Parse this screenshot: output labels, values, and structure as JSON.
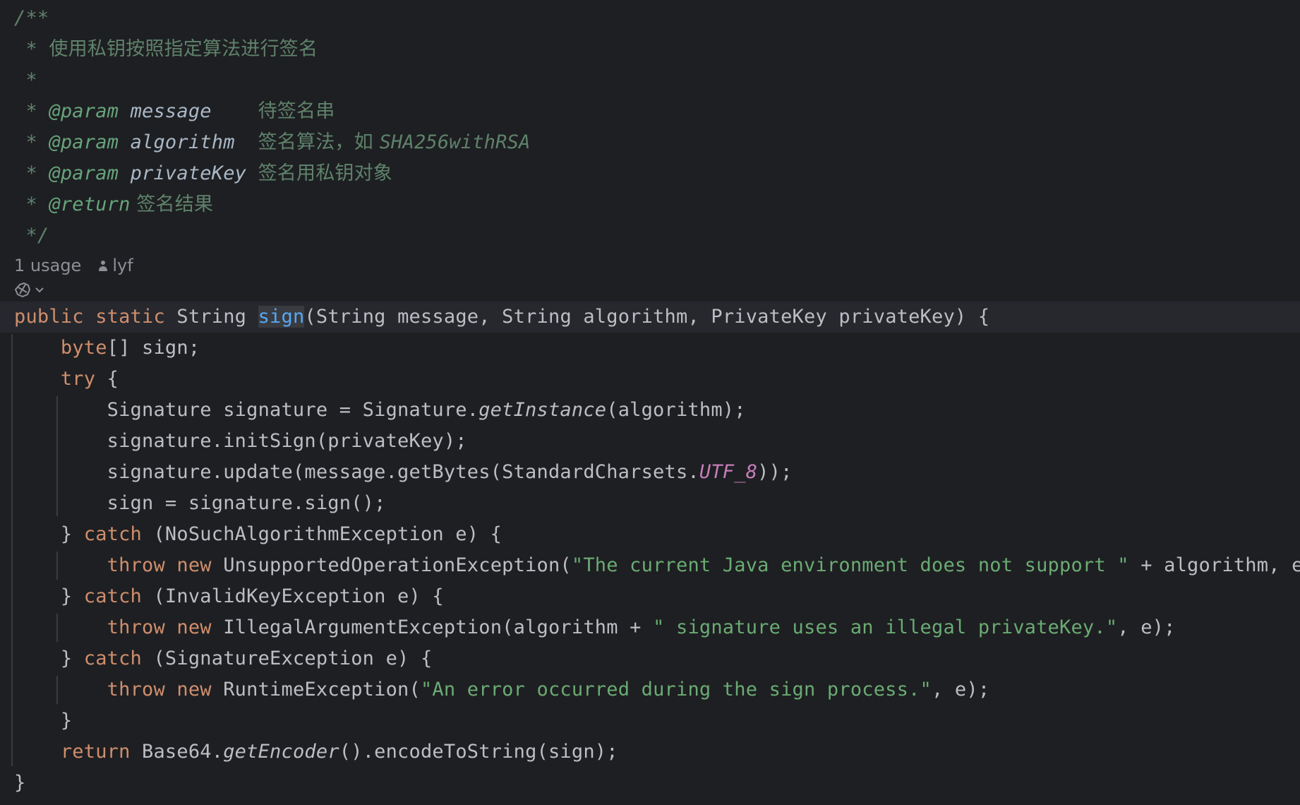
{
  "javadoc": {
    "open": "/**",
    "summary_star": " * ",
    "summary": "使用私钥按照指定算法进行签名",
    "blank": " *",
    "params": [
      {
        "star": " * ",
        "tag": "@param",
        "name": " message",
        "pad": "    ",
        "desc": "待签名串",
        "desc_code": ""
      },
      {
        "star": " * ",
        "tag": "@param",
        "name": " algorithm",
        "pad": "  ",
        "desc": "签名算法，如 ",
        "desc_code": "SHA256withRSA"
      },
      {
        "star": " * ",
        "tag": "@param",
        "name": " privateKey",
        "pad": " ",
        "desc": "签名用私钥对象",
        "desc_code": ""
      }
    ],
    "return_star": " * ",
    "return_tag": "@return",
    "return_desc": " 签名结果",
    "close": " */"
  },
  "inlay_hint": {
    "usages": "1 usage",
    "author": "lyf"
  },
  "code": {
    "signature": {
      "kw_public": "public",
      "kw_static": " static",
      "return_type": " String ",
      "name": "sign",
      "params": "(String message, String algorithm, PrivateKey privateKey) {"
    },
    "l_byte_kw": "    byte",
    "l_byte_rest": "[] sign;",
    "l_try_kw": "    try",
    "l_try_rest": " {",
    "l_sig_1": "        Signature signature = Signature.",
    "l_sig_2": "getInstance",
    "l_sig_3": "(algorithm);",
    "l_init": "        signature.initSign(privateKey);",
    "l_upd_1": "        signature.update(message.getBytes(StandardCharsets.",
    "l_upd_2": "UTF_8",
    "l_upd_3": "));",
    "l_sign": "        sign = signature.sign();",
    "catches": [
      {
        "open": "    } ",
        "kw": "catch",
        "type": " (NoSuchAlgorithmException e) {",
        "throw_indent": "        ",
        "throw_kw": "throw",
        "new_kw": " new",
        "ctor": " UnsupportedOperationException(",
        "pre": "",
        "str": "\"The current Java environment does not support \"",
        "post": " + algorithm, e);"
      },
      {
        "open": "    } ",
        "kw": "catch",
        "type": " (InvalidKeyException e) {",
        "throw_indent": "        ",
        "throw_kw": "throw",
        "new_kw": " new",
        "ctor": " IllegalArgumentException(",
        "pre": "algorithm + ",
        "str": "\" signature uses an illegal privateKey.\"",
        "post": ", e);"
      },
      {
        "open": "    } ",
        "kw": "catch",
        "type": " (SignatureException e) {",
        "throw_indent": "        ",
        "throw_kw": "throw",
        "new_kw": " new",
        "ctor": " RuntimeException(",
        "pre": "",
        "str": "\"An error occurred during the sign process.\"",
        "post": ", e);"
      }
    ],
    "l_close_try": "    }",
    "l_ret_kw": "    return",
    "l_ret_1": " Base64.",
    "l_ret_2": "getEncoder",
    "l_ret_3": "().encodeToString(sign);",
    "l_close_method": "}"
  },
  "colors": {
    "background": "#1e1f22",
    "keyword": "#cf8e6d",
    "string": "#6aab73",
    "method_decl": "#56a8f5",
    "doc_comment": "#5f826b",
    "constant": "#c77dbb",
    "text": "#bcbec4"
  },
  "icons": {
    "gutter": "ai-assistant-icon",
    "author": "person-icon"
  }
}
